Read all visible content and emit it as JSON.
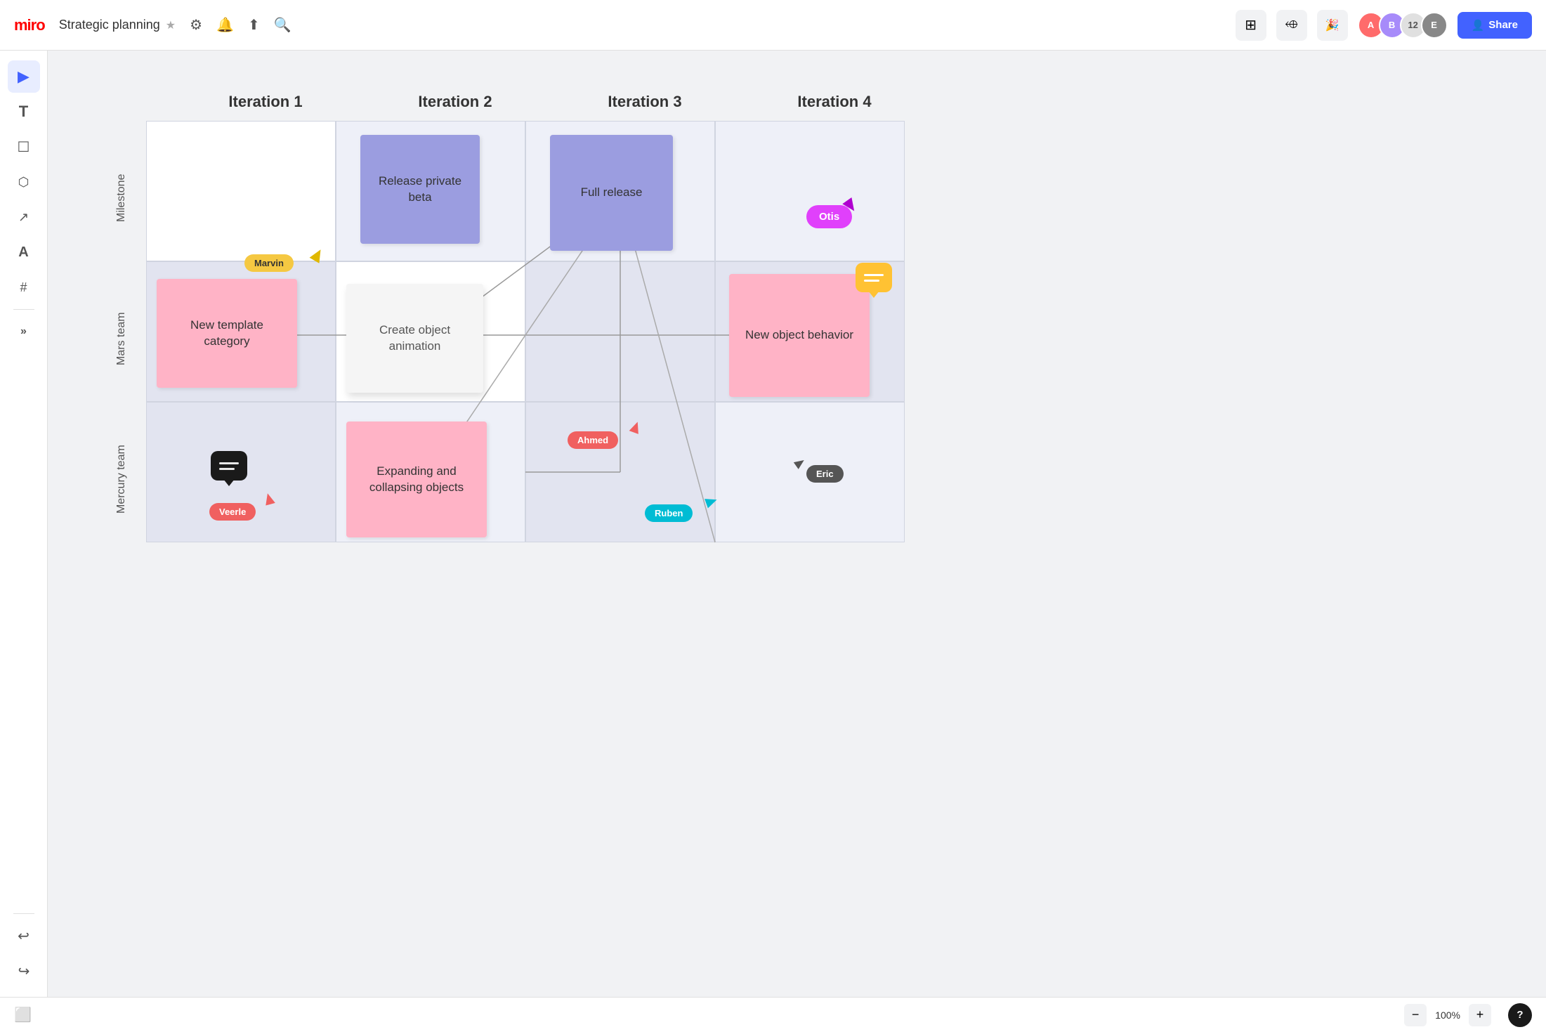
{
  "header": {
    "logo": "miro",
    "board_title": "Strategic planning",
    "star_icon": "★",
    "tools": [
      "⚙",
      "🔔",
      "⬆",
      "🔍"
    ],
    "share_label": "Share",
    "avatars": [
      {
        "color": "#ff6b6b",
        "initial": "A"
      },
      {
        "color": "#a78bfa",
        "initial": "B"
      },
      {
        "color": "#e0e0e0",
        "count": "12"
      },
      {
        "color": "#888",
        "initial": "E"
      }
    ]
  },
  "toolbar": {
    "tools": [
      {
        "name": "select",
        "icon": "▶"
      },
      {
        "name": "text",
        "icon": "T"
      },
      {
        "name": "note",
        "icon": "☐"
      },
      {
        "name": "shapes",
        "icon": "⬡"
      },
      {
        "name": "connector",
        "icon": "↗"
      },
      {
        "name": "pen",
        "icon": "A"
      },
      {
        "name": "frame",
        "icon": "#"
      },
      {
        "name": "more",
        "icon": "»"
      }
    ],
    "undo": "↩",
    "redo": "↪"
  },
  "columns": [
    "Iteration 1",
    "Iteration 2",
    "Iteration 3",
    "Iteration 4"
  ],
  "rows": [
    "Milestone",
    "Mars team",
    "Mercury team"
  ],
  "cards": {
    "release_private_beta": "Release private beta",
    "full_release": "Full release",
    "new_template_category": "New template category",
    "create_object_animation": "Create object animation",
    "new_object_behavior": "New object behavior",
    "expanding_collapsing": "Expanding and collapsing objects"
  },
  "cursors": [
    {
      "name": "Marvin",
      "color": "#f5c842"
    },
    {
      "name": "Ahmed",
      "color": "#f06060"
    },
    {
      "name": "Veerle",
      "color": "#f06060"
    },
    {
      "name": "Ruben",
      "color": "#00bcd4"
    },
    {
      "name": "Eric",
      "color": "#555"
    },
    {
      "name": "Otis",
      "color": "#e040fb"
    }
  ],
  "zoom": {
    "level": "100%",
    "minus": "−",
    "plus": "+"
  },
  "bottom": {
    "panel_icon": "⬜",
    "help": "?"
  }
}
